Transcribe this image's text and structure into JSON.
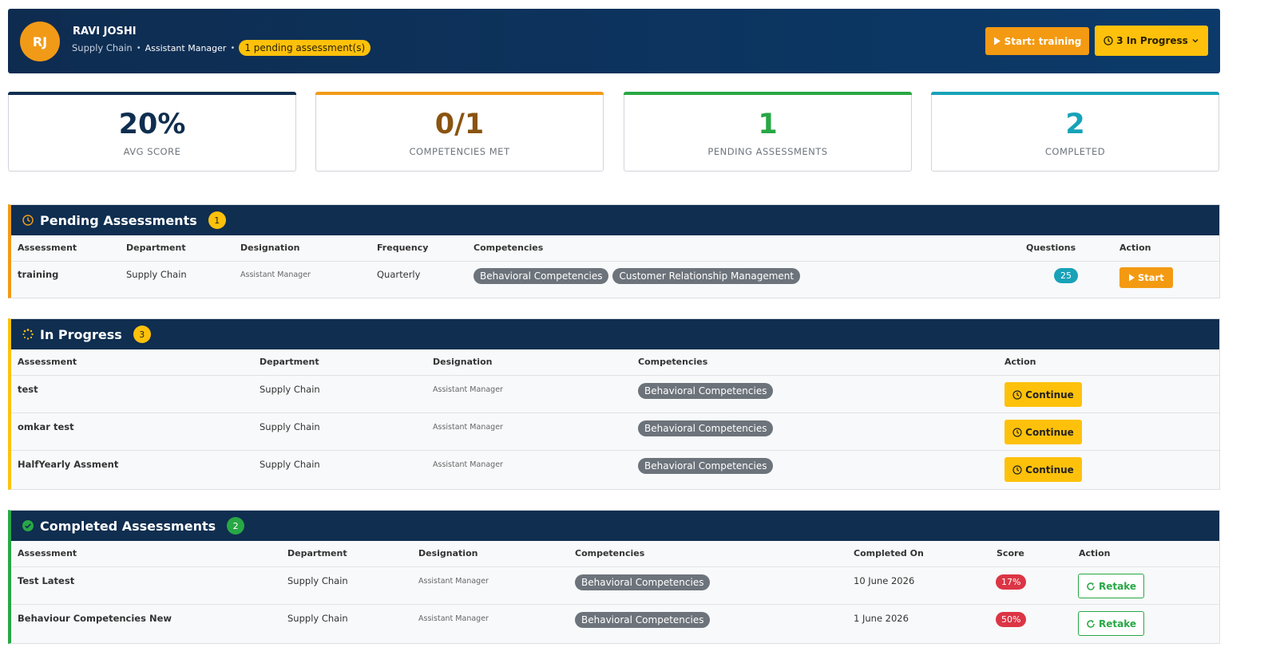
{
  "header": {
    "initials": "RJ",
    "name": "RAVI JOSHI",
    "department": "Supply Chain",
    "designation": "Assistant Manager",
    "pending_pill": "1 pending assessment(s)",
    "start_button": "Start: training",
    "in_progress_button": "3 In Progress"
  },
  "stats": [
    {
      "value": "20%",
      "label": "AVG SCORE",
      "color": "#0f2e50"
    },
    {
      "value": "0/1",
      "label": "COMPETENCIES MET",
      "color": "#8a5410"
    },
    {
      "value": "1",
      "label": "PENDING ASSESSMENTS",
      "color": "#28a745"
    },
    {
      "value": "2",
      "label": "COMPLETED",
      "color": "#17a2b8"
    }
  ],
  "pending": {
    "title": "Pending Assessments",
    "count": "1",
    "columns": [
      "Assessment",
      "Department",
      "Designation",
      "Frequency",
      "Competencies",
      "Questions",
      "Action"
    ],
    "rows": [
      {
        "assessment": "training",
        "department": "Supply Chain",
        "designation": "Assistant Manager",
        "frequency": "Quarterly",
        "competencies": [
          "Behavioral Competencies",
          "Customer Relationship Management"
        ],
        "questions": "25",
        "action": "Start"
      }
    ]
  },
  "in_progress": {
    "title": "In Progress",
    "count": "3",
    "columns": [
      "Assessment",
      "Department",
      "Designation",
      "Competencies",
      "Action"
    ],
    "rows": [
      {
        "assessment": "test",
        "department": "Supply Chain",
        "designation": "Assistant Manager",
        "competency": "Behavioral Competencies",
        "action": "Continue"
      },
      {
        "assessment": "omkar test",
        "department": "Supply Chain",
        "designation": "Assistant Manager",
        "competency": "Behavioral Competencies",
        "action": "Continue"
      },
      {
        "assessment": "HalfYearly Assment",
        "department": "Supply Chain",
        "designation": "Assistant Manager",
        "competency": "Behavioral Competencies",
        "action": "Continue"
      }
    ]
  },
  "completed": {
    "title": "Completed Assessments",
    "count": "2",
    "columns": [
      "Assessment",
      "Department",
      "Designation",
      "Competencies",
      "Completed On",
      "Score",
      "Action"
    ],
    "rows": [
      {
        "assessment": "Test Latest",
        "department": "Supply Chain",
        "designation": "Assistant Manager",
        "competency": "Behavioral Competencies",
        "completed_on": "10 June 2026",
        "score": "17%",
        "action": "Retake"
      },
      {
        "assessment": "Behaviour Competencies New",
        "department": "Supply Chain",
        "designation": "Assistant Manager",
        "competency": "Behavioral Competencies",
        "completed_on": "1 June 2026",
        "score": "50%",
        "action": "Retake"
      }
    ]
  }
}
